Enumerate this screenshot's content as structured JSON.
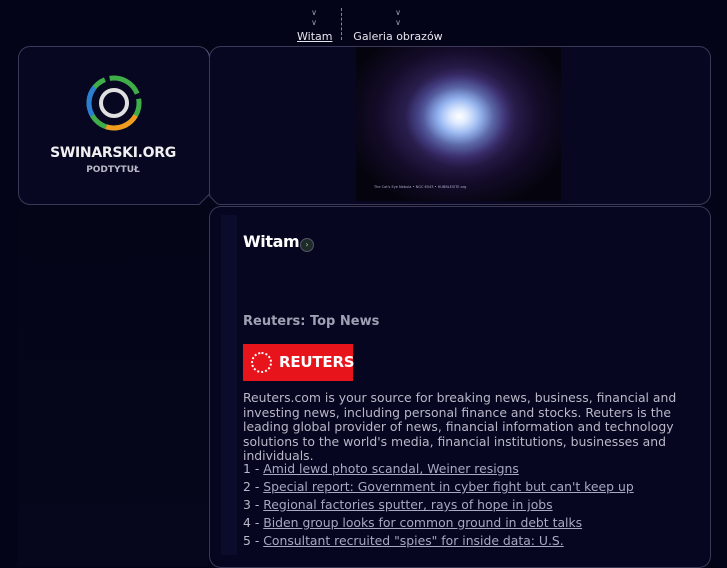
{
  "nav": {
    "items": [
      {
        "label": "Witam",
        "active": true
      },
      {
        "label": "Galeria obrazów",
        "active": false
      }
    ],
    "chevron_icon": "double-chevron-down-icon"
  },
  "site": {
    "name": "SWINARSKI.ORG",
    "subtitle": "PODTYTUŁ",
    "logo_colors": [
      "#3fae49",
      "#f29c1f",
      "#2a7fd4",
      "#e0e0e0"
    ]
  },
  "header_image": {
    "caption": "The Cat's Eye Nebula • NGC 6543 • HUBBLESITE.org"
  },
  "main": {
    "heading": "Witam",
    "heading_arrow_icon": "arrow-right-circle-icon",
    "feed_title": "Reuters: Top News",
    "feed_logo_text": "REUTERS",
    "feed_description": "Reuters.com is your source for breaking news, business, financial and investing news, including personal finance and stocks. Reuters is the leading global provider of news, financial information and technology solutions to the world's media, financial institutions, businesses and individuals.",
    "news": [
      {
        "num": "1 - ",
        "title": "Amid lewd photo scandal, Weiner resigns"
      },
      {
        "num": "2 - ",
        "title": "Special report: Government in cyber fight but can't keep up"
      },
      {
        "num": "3 - ",
        "title": "Regional factories sputter, rays of hope in jobs"
      },
      {
        "num": "4 - ",
        "title": "Biden group looks for common ground in debt talks"
      },
      {
        "num": "5 - ",
        "title": "Consultant recruited \"spies\" for inside data: U.S."
      }
    ]
  },
  "colors": {
    "background": "#040418",
    "reuters_red": "#e8141c"
  }
}
